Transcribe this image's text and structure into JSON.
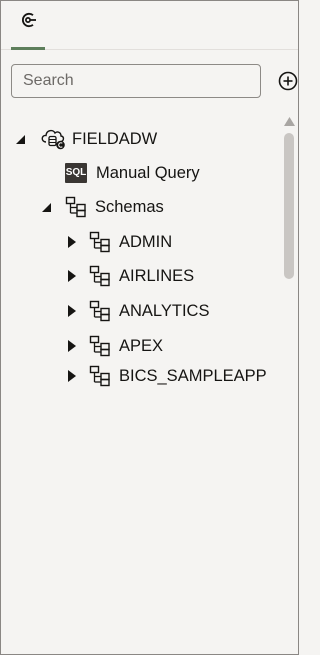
{
  "tabs": [
    {
      "name": "connections-tab",
      "icon": "connection-icon",
      "active": true
    }
  ],
  "search": {
    "placeholder": "Search",
    "value": ""
  },
  "add_button": {
    "icon": "plus-circle-icon"
  },
  "tree": {
    "root": {
      "label": "FIELDADW",
      "icon": "cloud-database-icon",
      "expanded": true
    },
    "manual_query": {
      "label": "Manual Query",
      "icon": "sql-icon",
      "badge": "SQL"
    },
    "schemas": {
      "label": "Schemas",
      "icon": "schema-icon",
      "expanded": true
    },
    "schema_items": [
      {
        "label": "ADMIN"
      },
      {
        "label": "AIRLINES"
      },
      {
        "label": "ANALYTICS"
      },
      {
        "label": "APEX"
      },
      {
        "label": "BICS_SAMPLEAPP"
      }
    ]
  },
  "colors": {
    "accent": "#5d7e5b",
    "background": "#f5f4f2",
    "text": "#161513",
    "sql_badge": "#3a3633"
  }
}
